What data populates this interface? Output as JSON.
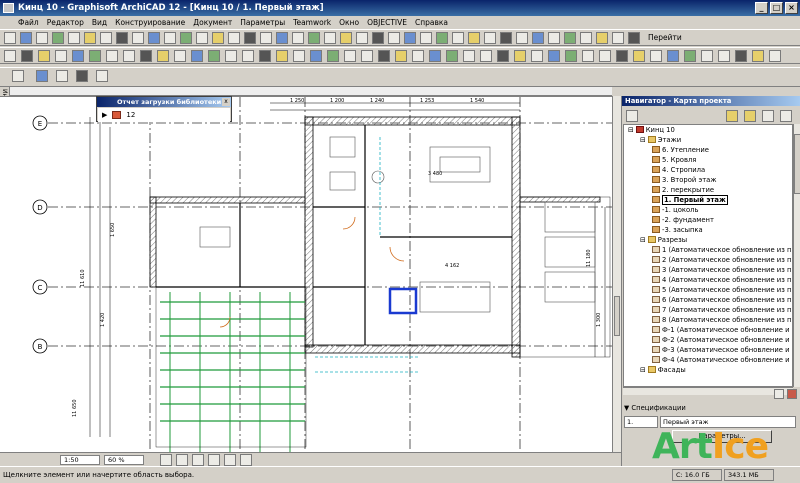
{
  "window": {
    "title": "Кинц 10 - Graphisoft ArchiCAD 12 - [Кинц 10 / 1. Первый этаж]",
    "buttons": [
      "_",
      "□",
      "×"
    ]
  },
  "menubar": {
    "items": [
      "Файл",
      "Редактор",
      "Вид",
      "Конструирование",
      "Документ",
      "Параметры",
      "Teamwork",
      "Окно",
      "OBJECTIVE",
      "Справка"
    ]
  },
  "toolbar": {
    "goto_label": "Перейти"
  },
  "leftbar": {
    "label": "Ин"
  },
  "library_report": {
    "title": "Отчет загрузки библиотеки",
    "count": "12"
  },
  "plan": {
    "grid_labels": [
      "E",
      "D",
      "C",
      "B"
    ],
    "dims": [
      "1 250",
      "1 200",
      "1 240",
      "1 253",
      "1 540",
      "3 480",
      "4 162",
      "11 610",
      "1 420",
      "1 650",
      "1 300",
      "11 650",
      "11 180"
    ]
  },
  "bottombar": {
    "scale": "1:50",
    "zoom": "60 %"
  },
  "status": {
    "hint": "Щелкните элемент или начертите область выбора.",
    "disk1": "C: 16.0 ГБ",
    "disk2": "343.1 МБ"
  },
  "navigator": {
    "title": "Навигатор - Карта проекта",
    "tree": [
      {
        "label": "Кинц 10",
        "level": 0,
        "icon": "proj"
      },
      {
        "label": "Этажи",
        "level": 1,
        "icon": "folder"
      },
      {
        "label": "6. Утепление",
        "level": 2,
        "icon": "story"
      },
      {
        "label": "5. Кровля",
        "level": 2,
        "icon": "story"
      },
      {
        "label": "4. Стропила",
        "level": 2,
        "icon": "story"
      },
      {
        "label": "3. Второй этаж",
        "level": 2,
        "icon": "story"
      },
      {
        "label": "2. перекрытие",
        "level": 2,
        "icon": "story"
      },
      {
        "label": "1. Первый этаж",
        "level": 2,
        "icon": "story",
        "selected": true
      },
      {
        "label": "-1. цоколь",
        "level": 2,
        "icon": "story"
      },
      {
        "label": "-2. фундамент",
        "level": 2,
        "icon": "story"
      },
      {
        "label": "-3. засыпка",
        "level": 2,
        "icon": "story"
      },
      {
        "label": "Разрезы",
        "level": 1,
        "icon": "folder"
      },
      {
        "label": "1 (Автоматическое обновление из п",
        "level": 2,
        "icon": "section"
      },
      {
        "label": "2 (Автоматическое обновление из п",
        "level": 2,
        "icon": "section"
      },
      {
        "label": "3 (Автоматическое обновление из п",
        "level": 2,
        "icon": "section"
      },
      {
        "label": "4 (Автоматическое обновление из п",
        "level": 2,
        "icon": "section"
      },
      {
        "label": "5 (Автоматическое обновление из п",
        "level": 2,
        "icon": "section"
      },
      {
        "label": "6 (Автоматическое обновление из п",
        "level": 2,
        "icon": "section"
      },
      {
        "label": "7 (Автоматическое обновление из п",
        "level": 2,
        "icon": "section"
      },
      {
        "label": "8 (Автоматическое обновление из п",
        "level": 2,
        "icon": "section"
      },
      {
        "label": "Ф-1 (Автоматическое обновление и",
        "level": 2,
        "icon": "section"
      },
      {
        "label": "Ф-2 (Автоматическое обновление и",
        "level": 2,
        "icon": "section"
      },
      {
        "label": "Ф-3 (Автоматическое обновление и",
        "level": 2,
        "icon": "section"
      },
      {
        "label": "Ф-4 (Автоматическое обновление и",
        "level": 2,
        "icon": "section"
      },
      {
        "label": "Фасады",
        "level": 1,
        "icon": "folder"
      }
    ],
    "specs_label": "Спецификации",
    "spec_index": "1.",
    "spec_value": "Первый этаж",
    "params_button": "Параметры..."
  },
  "watermark": {
    "a": "Art",
    "b": "Ice"
  }
}
